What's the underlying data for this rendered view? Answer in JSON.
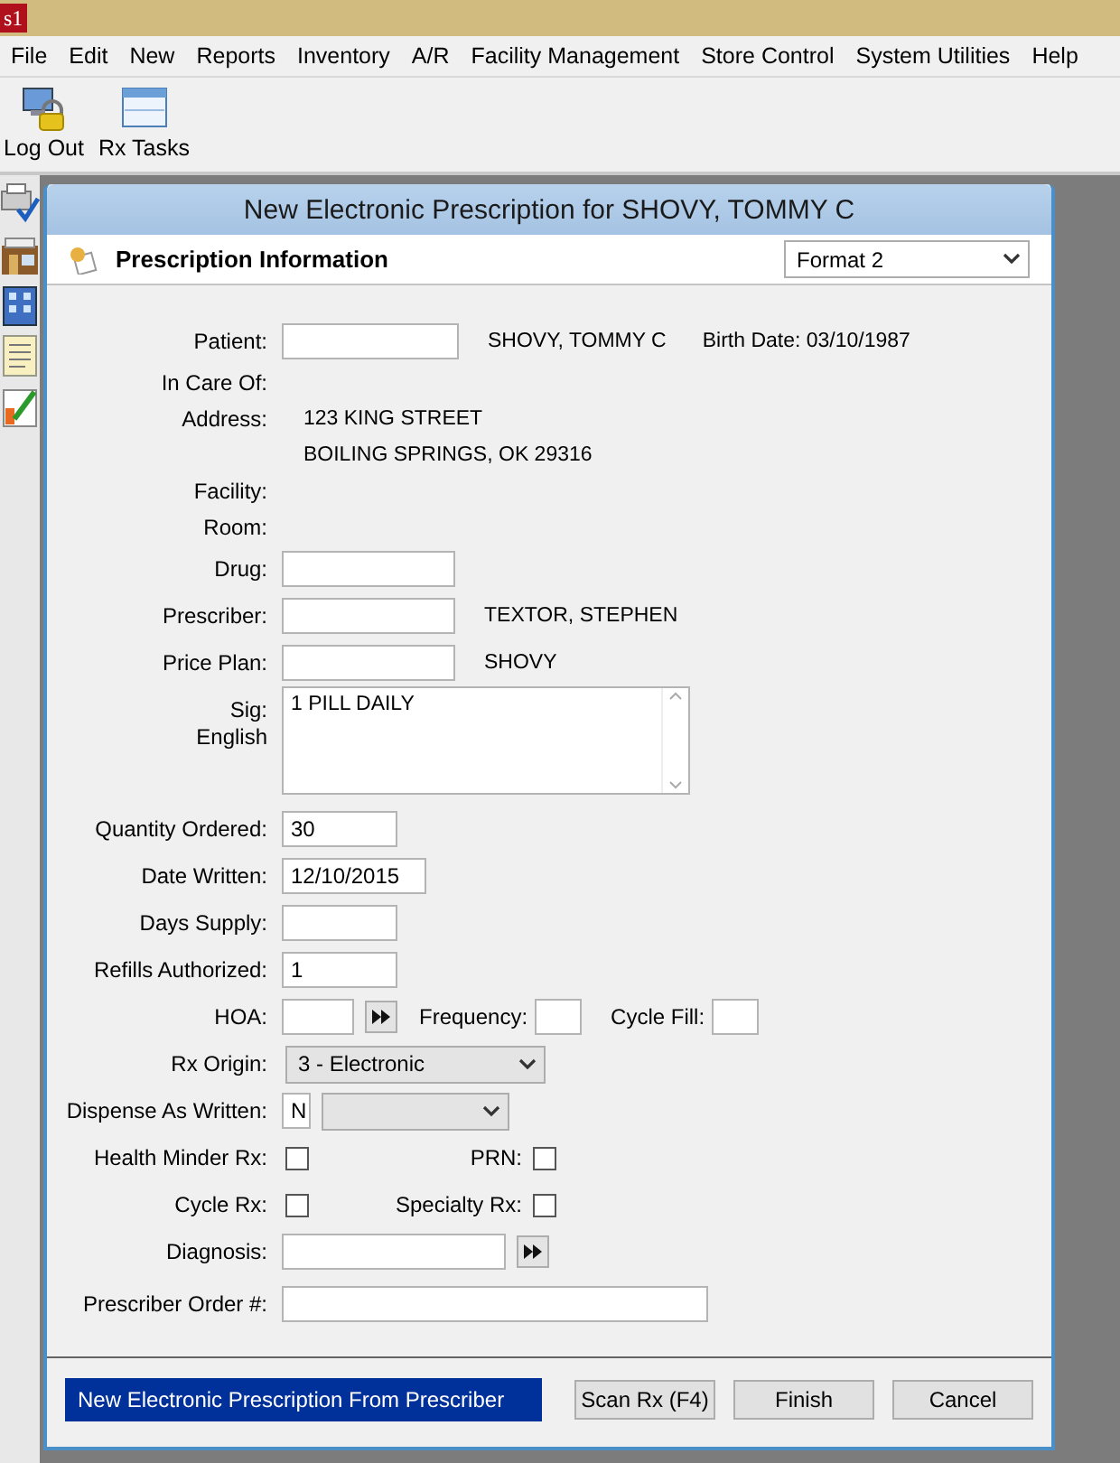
{
  "app_logo": "s1",
  "menu": [
    "File",
    "Edit",
    "New",
    "Reports",
    "Inventory",
    "A/R",
    "Facility Management",
    "Store Control",
    "System Utilities",
    "Help"
  ],
  "toolbar": [
    {
      "kind": "logout",
      "label": "Log Out"
    },
    {
      "kind": "tasks",
      "label": "Rx Tasks"
    }
  ],
  "dialog": {
    "title": "New Electronic Prescription for SHOVY, TOMMY C",
    "header": "Prescription Information",
    "format": "Format 2",
    "rows": [
      {
        "label": "Patient:",
        "items": [
          {
            "kind": "input",
            "value": ""
          },
          {
            "kind": "text",
            "text": "SHOVY, TOMMY C"
          },
          {
            "kind": "text",
            "text": "Birth Date: 03/10/1987"
          }
        ]
      },
      {
        "label": "In Care Of:",
        "items": []
      },
      {
        "label": "Address:",
        "items": [
          {
            "kind": "text",
            "text": "123 KING STREET"
          }
        ]
      },
      {
        "items": [
          {
            "kind": "text",
            "text": "BOILING SPRINGS, OK 29316"
          }
        ]
      },
      {
        "label": "Facility:",
        "items": []
      },
      {
        "label": "Room:",
        "items": []
      },
      {
        "label": "Drug:",
        "items": [
          {
            "kind": "input",
            "value": ""
          }
        ]
      },
      {
        "label": "Prescriber:",
        "items": [
          {
            "kind": "input",
            "value": ""
          },
          {
            "kind": "text",
            "text": "TEXTOR, STEPHEN"
          }
        ]
      },
      {
        "label": "Price Plan:",
        "items": [
          {
            "kind": "input",
            "value": ""
          },
          {
            "kind": "text",
            "text": "SHOVY"
          }
        ]
      },
      {
        "label": "Sig:",
        "sublabel": "English",
        "items": [
          {
            "kind": "textarea",
            "value": "1 PILL DAILY"
          }
        ]
      },
      {
        "label": "Quantity Ordered:",
        "items": [
          {
            "kind": "input",
            "value": "30"
          }
        ]
      },
      {
        "label": "Date Written:",
        "items": [
          {
            "kind": "input",
            "value": "12/10/2015"
          }
        ]
      },
      {
        "label": "Days Supply:",
        "items": [
          {
            "kind": "input",
            "value": ""
          }
        ]
      },
      {
        "label": "Refills Authorized:",
        "items": [
          {
            "kind": "input",
            "value": "1"
          }
        ]
      },
      {
        "label": "HOA:",
        "items": [
          {
            "kind": "input",
            "value": ""
          },
          {
            "kind": "lookup"
          },
          {
            "kind": "label",
            "text": "Frequency:"
          },
          {
            "kind": "input",
            "value": ""
          },
          {
            "kind": "label",
            "text": "Cycle Fill:"
          },
          {
            "kind": "input",
            "value": ""
          }
        ]
      },
      {
        "label": "Rx Origin:",
        "items": [
          {
            "kind": "select",
            "value": "3 - Electronic"
          }
        ]
      },
      {
        "label": "Dispense As Written:",
        "items": [
          {
            "kind": "input",
            "value": "N"
          },
          {
            "kind": "select"
          }
        ]
      },
      {
        "label": "Health Minder Rx:",
        "items": [
          {
            "kind": "checkbox",
            "checked": false
          },
          {
            "kind": "label",
            "text": "PRN:"
          },
          {
            "kind": "checkbox",
            "checked": false
          }
        ]
      },
      {
        "label": "Cycle Rx:",
        "items": [
          {
            "kind": "checkbox",
            "checked": false
          },
          {
            "kind": "label",
            "text": "Specialty Rx:"
          },
          {
            "kind": "checkbox",
            "checked": false
          }
        ]
      },
      {
        "label": "Diagnosis:",
        "items": [
          {
            "kind": "input",
            "value": ""
          },
          {
            "kind": "lookup"
          }
        ]
      },
      {
        "label": "Prescriber Order #:",
        "items": [
          {
            "kind": "input",
            "value": ""
          }
        ]
      }
    ],
    "status": "New Electronic Prescription From Prescriber",
    "buttons": [
      "Scan Rx (F4)",
      "Finish",
      "Cancel"
    ]
  }
}
